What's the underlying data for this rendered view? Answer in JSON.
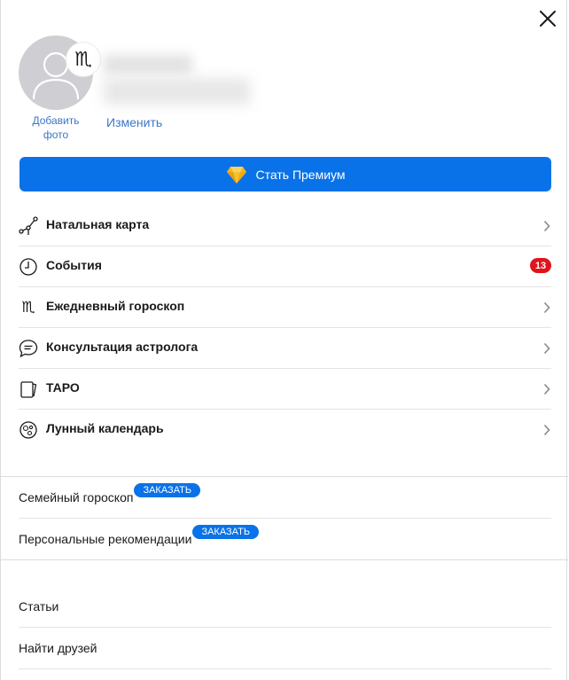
{
  "profile": {
    "add_photo_label": "Добавить фото",
    "edit_label": "Изменить",
    "zodiac_symbol": "♏"
  },
  "premium": {
    "label": "Стать Премиум",
    "icon": "diamond-icon"
  },
  "menu": {
    "items": [
      {
        "label": "Натальная карта",
        "icon": "natal-chart-icon"
      },
      {
        "label": "События",
        "icon": "clock-icon",
        "badge": "13"
      },
      {
        "label": "Ежедневный гороскоп",
        "icon": "scorpio-icon"
      },
      {
        "label": "Консультация астролога",
        "icon": "chat-bubble-icon"
      },
      {
        "label": "ТАРО",
        "icon": "tarot-card-icon"
      },
      {
        "label": "Лунный календарь",
        "icon": "moon-icon"
      }
    ]
  },
  "extras": {
    "items": [
      {
        "label": "Семейный гороскоп",
        "badge": "ЗАКАЗАТЬ"
      },
      {
        "label": "Персональные рекомендации",
        "badge": "ЗАКАЗАТЬ"
      }
    ]
  },
  "links": {
    "items": [
      {
        "label": "Статьи"
      },
      {
        "label": "Найти друзей"
      }
    ]
  },
  "colors": {
    "accent": "#0a72e8",
    "link": "#3a77c6",
    "badge_red": "#e0141b",
    "gem": "#f5b719"
  }
}
